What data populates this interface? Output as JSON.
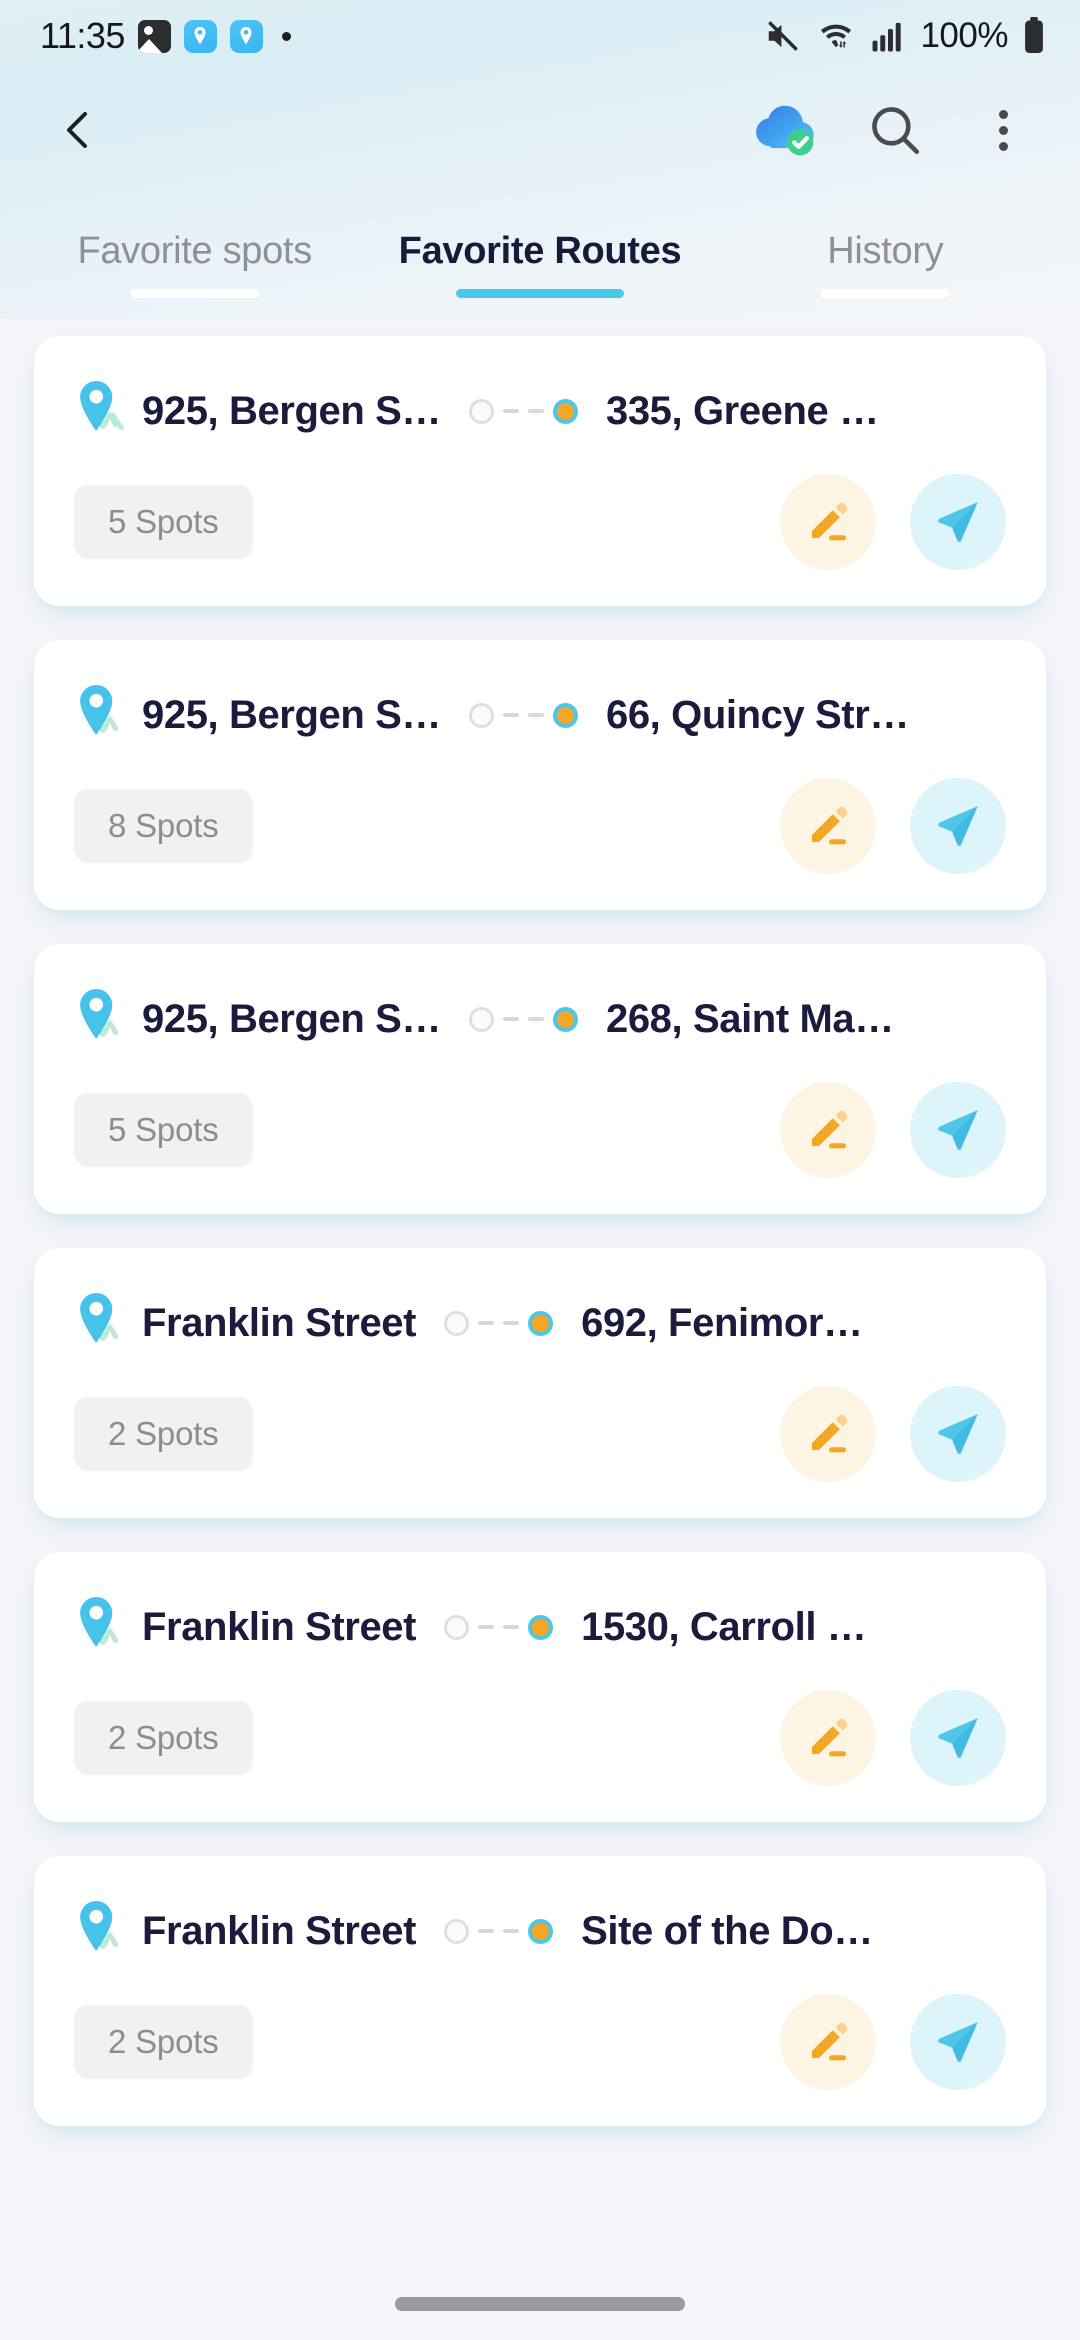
{
  "status_bar": {
    "time": "11:35",
    "battery_percent": "100%",
    "icons": [
      "photo-icon",
      "map-app-icon",
      "map-app-icon",
      "notification-dot",
      "mute-icon",
      "wifi-icon",
      "cellular-signal-icon",
      "battery-icon"
    ]
  },
  "toolbar": {
    "back_icon": "back-chevron-icon",
    "cloud_sync_icon": "cloud-sync-check-icon",
    "search_icon": "search-icon",
    "menu_icon": "overflow-menu-icon"
  },
  "tabs": [
    {
      "label": "Favorite spots",
      "active": false
    },
    {
      "label": "Favorite Routes",
      "active": true
    },
    {
      "label": "History",
      "active": false
    }
  ],
  "colors": {
    "accent_cyan": "#48c8e8",
    "pin_cyan": "#45c4e8",
    "edit_orange": "#f5a623",
    "text_navy": "#1b1c3d",
    "muted_gray": "#8e9096",
    "card_white": "#ffffff",
    "page_bg": "#f4f5f8"
  },
  "routes": [
    {
      "origin": "925, Bergen S…",
      "destination": "335, Greene …",
      "spots": "5 Spots",
      "edit_label": "edit-route",
      "go_label": "start-navigation"
    },
    {
      "origin": "925, Bergen S…",
      "destination": "66, Quincy Str…",
      "spots": "8 Spots",
      "edit_label": "edit-route",
      "go_label": "start-navigation"
    },
    {
      "origin": "925, Bergen S…",
      "destination": "268, Saint Ma…",
      "spots": "5 Spots",
      "edit_label": "edit-route",
      "go_label": "start-navigation"
    },
    {
      "origin": "Franklin Street",
      "destination": "692, Fenimor…",
      "spots": "2 Spots",
      "edit_label": "edit-route",
      "go_label": "start-navigation"
    },
    {
      "origin": "Franklin Street",
      "destination": "1530, Carroll …",
      "spots": "2 Spots",
      "edit_label": "edit-route",
      "go_label": "start-navigation"
    },
    {
      "origin": "Franklin Street",
      "destination": "Site of the Do…",
      "spots": "2 Spots",
      "edit_label": "edit-route",
      "go_label": "start-navigation"
    }
  ]
}
